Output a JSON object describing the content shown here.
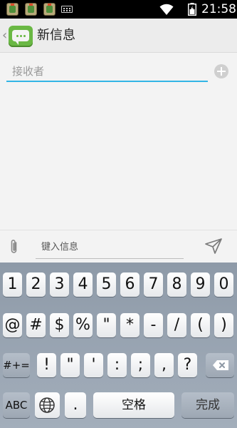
{
  "status_bar": {
    "time": "21:58",
    "icons": [
      "app-notification-icon",
      "app-notification-icon",
      "app-notification-icon",
      "keyboard-notification-icon",
      "wifi-icon",
      "battery-icon"
    ]
  },
  "action_bar": {
    "title": "新信息",
    "back_glyph": "‹"
  },
  "recipient": {
    "placeholder": "接收者",
    "value": ""
  },
  "compose": {
    "placeholder": "键入信息",
    "value": ""
  },
  "keyboard": {
    "row1": [
      "1",
      "2",
      "3",
      "4",
      "5",
      "6",
      "7",
      "8",
      "9",
      "0"
    ],
    "row2": [
      "@",
      "#",
      "$",
      "%",
      "\"",
      "*",
      "-",
      "/",
      "(",
      ")"
    ],
    "row3": [
      "#+=",
      "!",
      "\"",
      "'",
      ":",
      ";",
      ",",
      "?"
    ],
    "row4": {
      "abc": "ABC",
      "period": ".",
      "space": "空格",
      "done": "完成"
    }
  },
  "colors": {
    "accent": "#33b5e5",
    "app_icon": "#6ab844",
    "status_bar": "#000000"
  }
}
